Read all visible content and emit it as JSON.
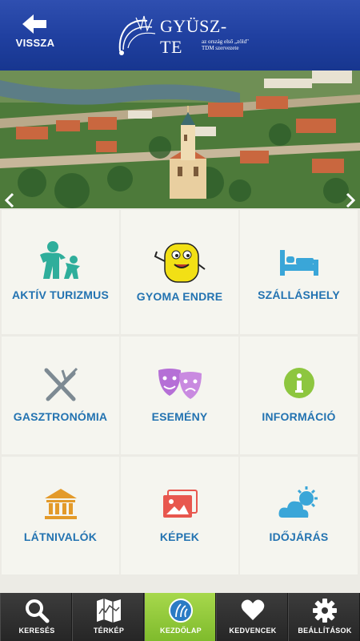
{
  "header": {
    "back_label": "VISSZA",
    "logo_title": "GYÜSZ-TE",
    "logo_subtitle": "az ország első „zöld\" TDM szervezete"
  },
  "tiles": [
    {
      "label": "AKTÍV TURIZMUS",
      "icon": "family-icon",
      "color": "#2fae9b"
    },
    {
      "label": "GYOMA ENDRE",
      "icon": "mascot-icon",
      "color": "#f2e015"
    },
    {
      "label": "SZÁLLÁSHELY",
      "icon": "bed-icon",
      "color": "#3aa6d8"
    },
    {
      "label": "GASZTRONÓMIA",
      "icon": "fork-knife-icon",
      "color": "#7d8a93"
    },
    {
      "label": "ESEMÉNY",
      "icon": "theatre-masks-icon",
      "color": "#b56fd6"
    },
    {
      "label": "INFORMÁCIÓ",
      "icon": "info-icon",
      "color": "#8dc63f"
    },
    {
      "label": "LÁTNIVALÓK",
      "icon": "museum-icon",
      "color": "#e39a2a"
    },
    {
      "label": "KÉPEK",
      "icon": "pictures-icon",
      "color": "#e8574e"
    },
    {
      "label": "IDŐJÁRÁS",
      "icon": "weather-icon",
      "color": "#3aa6d8"
    }
  ],
  "tabbar": [
    {
      "label": "KERESÉS",
      "icon": "search-icon"
    },
    {
      "label": "TÉRKÉP",
      "icon": "map-icon"
    },
    {
      "label": "KEZDŐLAP",
      "icon": "home-logo-icon",
      "active": true
    },
    {
      "label": "KEDVENCEK",
      "icon": "heart-icon"
    },
    {
      "label": "BEÁLLÍTÁSOK",
      "icon": "gear-icon"
    }
  ]
}
